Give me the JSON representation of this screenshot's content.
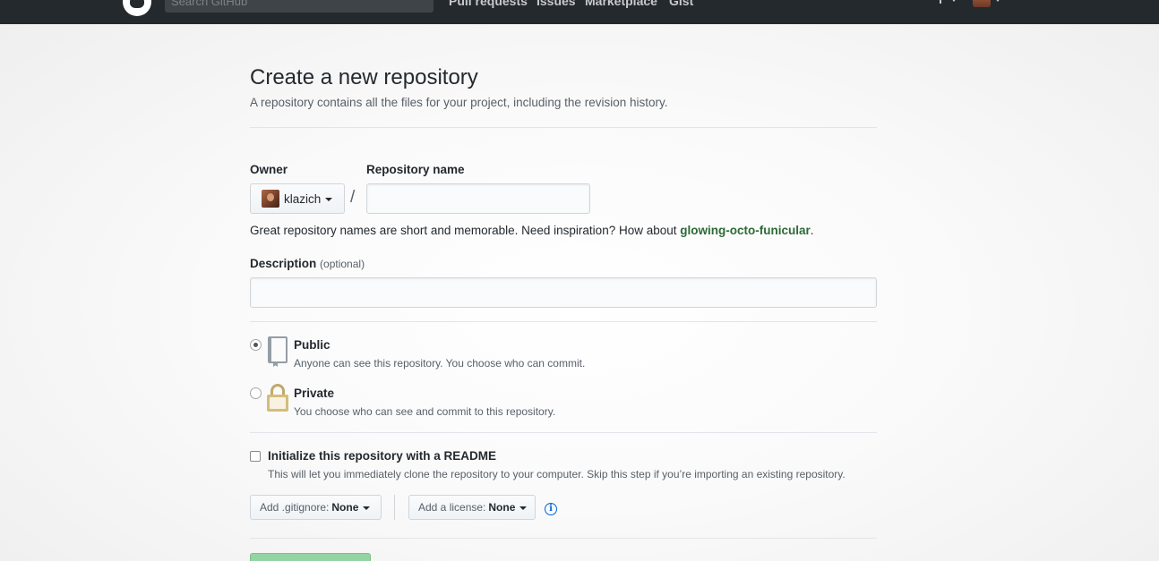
{
  "header": {
    "search_placeholder": "Search GitHub",
    "nav": [
      "Pull requests",
      "Issues",
      "Marketplace",
      "Gist"
    ]
  },
  "page": {
    "title": "Create a new repository",
    "subtitle": "A repository contains all the files for your project, including the revision history."
  },
  "form": {
    "owner_label": "Owner",
    "owner_value": "klazich",
    "slash": "/",
    "repo_name_label": "Repository name",
    "repo_name_value": "",
    "hint_prefix": "Great repository names are short and memorable. Need inspiration? How about ",
    "hint_suggestion": "glowing-octo-funicular",
    "hint_suffix": ".",
    "description_label": "Description",
    "description_optional": "(optional)",
    "description_value": ""
  },
  "visibility": {
    "selected": "public",
    "public_title": "Public",
    "public_desc": "Anyone can see this repository. You choose who can commit.",
    "private_title": "Private",
    "private_desc": "You choose who can see and commit to this repository."
  },
  "readme": {
    "checked": false,
    "title": "Initialize this repository with a README",
    "desc": "This will let you immediately clone the repository to your computer. Skip this step if you’re importing an existing repository."
  },
  "selects": {
    "gitignore_label": "Add .gitignore:",
    "gitignore_value": "None",
    "license_label": "Add a license:",
    "license_value": "None"
  },
  "colors": {
    "suggestion": "#2c6a36",
    "create_button": "#94d3a2",
    "info_icon": "#0366d6"
  },
  "icons": [
    "github-logo-icon",
    "plus-icon",
    "repo-icon",
    "lock-icon",
    "info-icon",
    "caret-down-icon"
  ]
}
